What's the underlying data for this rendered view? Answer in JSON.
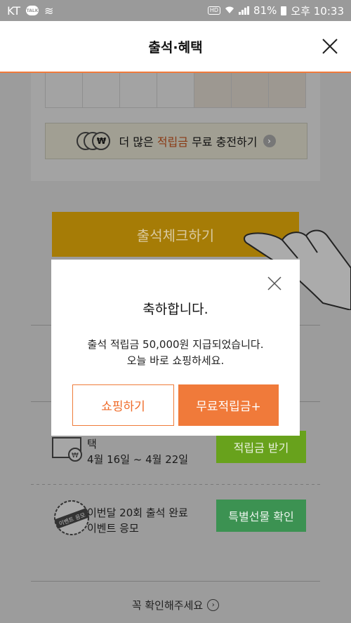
{
  "status_bar": {
    "carrier": "KT",
    "talk_badge": "TALK",
    "hd_label": "HD",
    "battery": "81%",
    "time": "오후 10:33"
  },
  "header": {
    "title": "출석·혜택"
  },
  "promo": {
    "text_pre": "더 많은 ",
    "text_em": "적립금",
    "text_post": " 무료 충전하기",
    "coin_symbol": "₩"
  },
  "check_button": {
    "label": "출석체크하기"
  },
  "rows": [
    {
      "title": "택",
      "subtitle": "4월 16일 ~ 4월 22일",
      "action": "적립금 받기"
    },
    {
      "title": "이번달 20회 출석 완료",
      "subtitle": "이벤트 응모",
      "action": "특별선물 확인",
      "stamp": "이벤트 응모"
    }
  ],
  "footer": {
    "label": "꼭 확인해주세요"
  },
  "modal": {
    "title": "축하합니다.",
    "line1": "출석 적립금 50,000원 지급되었습니다.",
    "line2": "오늘 바로 쇼핑하세요.",
    "btn_shop": "쇼핑하기",
    "btn_free": "무료적립금+"
  },
  "colors": {
    "accent": "#f07a3a",
    "green_light": "#68a21c",
    "green_dark": "#3c9252",
    "dim_yellow": "#a67c06"
  }
}
